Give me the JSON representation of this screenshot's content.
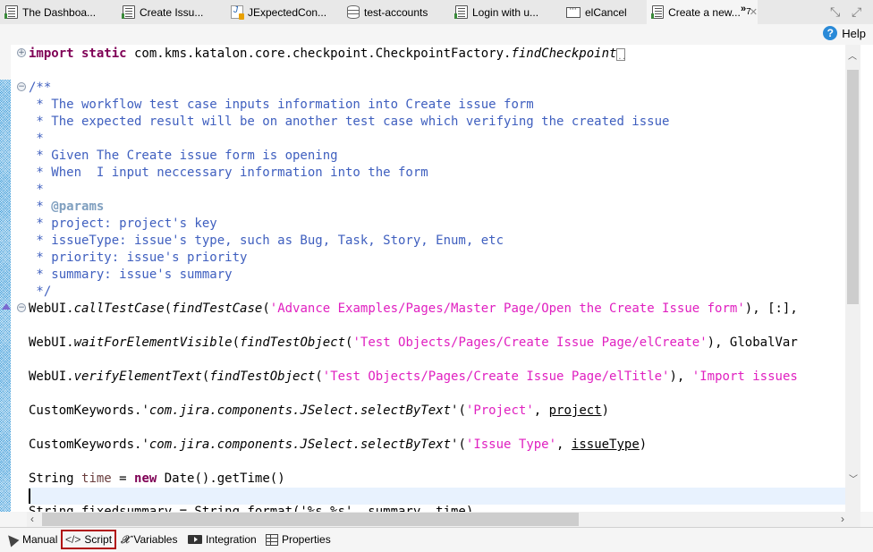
{
  "tabs": [
    {
      "label": "The Dashboa...",
      "icon": "test-case-icon"
    },
    {
      "label": "Create Issu...",
      "icon": "test-case-icon"
    },
    {
      "label": "JExpectedCon...",
      "icon": "java-file-icon"
    },
    {
      "label": "test-accounts",
      "icon": "database-icon"
    },
    {
      "label": "Login with u...",
      "icon": "test-case-icon"
    },
    {
      "label": "elCancel",
      "icon": "test-object-icon"
    },
    {
      "label": "Create a new...",
      "icon": "test-case-icon",
      "active": true
    }
  ],
  "overflow": {
    "glyph": "»",
    "count": "7"
  },
  "help": {
    "label": "Help"
  },
  "editor": {
    "lines": {
      "import_kw": "import static",
      "import_path": " com.kms.katalon.core.checkpoint.CheckpointFactory.",
      "import_method": "findCheckpoint",
      "doc_open": "/**",
      "doc1": " * The workflow test case inputs information into Create issue form",
      "doc2": " * The expected result will be on another test case which verifying the created issue",
      "doc3": " *",
      "doc4": " * Given The Create issue form is opening",
      "doc5": " * When  I input neccessary information into the form",
      "doc6": " *",
      "doc7_star": " * ",
      "doc7_tag": "@params",
      "doc8": " * project: project's key",
      "doc9": " * issueType: issue's type, such as Bug, Task, Story, Enum, etc",
      "doc10": " * priority: issue's priority",
      "doc11": " * summary: issue's summary",
      "doc_close": " */",
      "l1_a": "WebUI.",
      "l1_b": "callTestCase",
      "l1_c": "(",
      "l1_d": "findTestCase",
      "l1_e": "(",
      "l1_str": "'Advance Examples/Pages/Master Page/Open the Create Issue form'",
      "l1_f": "), [:],",
      "l2_a": "WebUI.",
      "l2_b": "waitForElementVisible",
      "l2_c": "(",
      "l2_d": "findTestObject",
      "l2_e": "(",
      "l2_str": "'Test Objects/Pages/Create Issue Page/elCreate'",
      "l2_f": "), GlobalVar",
      "l3_a": "WebUI.",
      "l3_b": "verifyElementText",
      "l3_c": "(",
      "l3_d": "findTestObject",
      "l3_e": "(",
      "l3_str": "'Test Objects/Pages/Create Issue Page/elTitle'",
      "l3_f": "), ",
      "l3_str2": "'Import issues",
      "l4_a": "CustomKeywords.",
      "l4_b": "'com.jira.components.JSelect.selectByText'",
      "l4_c": "(",
      "l4_str": "'Project'",
      "l4_d": ", ",
      "l4_var": "project",
      "l4_e": ")",
      "l5_a": "CustomKeywords.",
      "l5_b": "'com.jira.components.JSelect.selectByText'",
      "l5_c": "(",
      "l5_str": "'Issue Type'",
      "l5_d": ", ",
      "l5_var": "issueType",
      "l5_e": ")",
      "l6_a": "String ",
      "l6_var": "time",
      "l6_b": " = ",
      "l6_kw": "new",
      "l6_c": " Date().getTime()",
      "l7_partial": "String fixedsummary = String.format('%s %s', summary, time)"
    }
  },
  "bottom_tabs": [
    {
      "label": "Manual",
      "icon": "cursor-icon"
    },
    {
      "label": "Script",
      "icon": "code-icon",
      "selected": true,
      "glyph": "</>"
    },
    {
      "label": "Variables",
      "icon": "variable-icon",
      "glyph": "𝒳"
    },
    {
      "label": "Integration",
      "icon": "integration-icon"
    },
    {
      "label": "Properties",
      "icon": "properties-icon"
    }
  ]
}
